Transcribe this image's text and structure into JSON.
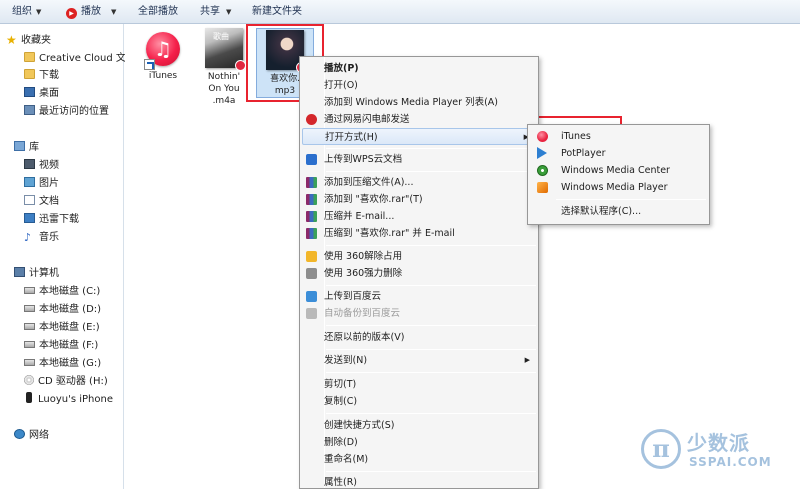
{
  "toolbar": {
    "organize": "组织",
    "play": "播放",
    "play_all": "全部播放",
    "share": "共享",
    "new_folder": "新建文件夹"
  },
  "nav": {
    "favorites_header": "收藏夹",
    "favorites": [
      "Creative Cloud 文件",
      "下载",
      "桌面",
      "最近访问的位置"
    ],
    "libraries_header": "库",
    "libraries": [
      "视频",
      "图片",
      "文档",
      "迅雷下载",
      "音乐"
    ],
    "computer_header": "计算机",
    "drives": [
      "本地磁盘 (C:)",
      "本地磁盘 (D:)",
      "本地磁盘 (E:)",
      "本地磁盘 (F:)",
      "本地磁盘 (G:)",
      "CD 驱动器 (H:)",
      "Luoyu's iPhone"
    ],
    "network": "网络"
  },
  "files": [
    {
      "label": "iTunes",
      "icon": "itunes-shortcut-icon"
    },
    {
      "label": "Nothin'\nOn You\n.m4a",
      "icon": "album-art-icon",
      "album_text": "歌曲"
    },
    {
      "label": "喜欢你.\nmp3",
      "icon": "album-art-icon",
      "selected": true
    }
  ],
  "context_menu": {
    "items": [
      {
        "label": "播放(P)",
        "bold": true
      },
      {
        "label": "打开(O)"
      },
      {
        "label": "添加到 Windows Media Player 列表(A)"
      },
      {
        "label": "通过网易闪电邮发送",
        "icon": "netease-mail-icon"
      },
      {
        "label": "打开方式(H)",
        "submenu": true
      },
      {
        "label": "上传到WPS云文档",
        "icon": "wps-icon"
      },
      {
        "label": "添加到压缩文件(A)...",
        "icon": "winrar-icon"
      },
      {
        "label": "添加到 \"喜欢你.rar\"(T)",
        "icon": "winrar-icon"
      },
      {
        "label": "压缩并 E-mail...",
        "icon": "winrar-icon"
      },
      {
        "label": "压缩到 \"喜欢你.rar\" 并 E-mail",
        "icon": "winrar-icon"
      },
      {
        "label": "使用 360解除占用",
        "icon": "360-unlock-icon"
      },
      {
        "label": "使用 360强力删除",
        "icon": "360-delete-icon"
      },
      {
        "label": "上传到百度云",
        "icon": "baidu-cloud-icon"
      },
      {
        "label": "自动备份到百度云",
        "icon": "baidu-cloud-icon",
        "disabled": true
      },
      {
        "label": "还原以前的版本(V)"
      },
      {
        "label": "发送到(N)",
        "submenu": true
      },
      {
        "label": "剪切(T)"
      },
      {
        "label": "复制(C)"
      },
      {
        "label": "创建快捷方式(S)"
      },
      {
        "label": "删除(D)"
      },
      {
        "label": "重命名(M)"
      },
      {
        "label": "属性(R)"
      }
    ]
  },
  "open_with": {
    "items": [
      {
        "label": "iTunes",
        "icon": "itunes-icon"
      },
      {
        "label": "PotPlayer",
        "icon": "potplayer-icon"
      },
      {
        "label": "Windows Media Center",
        "icon": "wmc-icon"
      },
      {
        "label": "Windows Media Player",
        "icon": "wmp-icon"
      },
      {
        "label": "选择默认程序(C)..."
      }
    ]
  },
  "watermark": {
    "cn": "少数派",
    "en": "SSPAI.COM"
  },
  "colors": {
    "highlight_box": "#e8232f",
    "menu_hover": "#dbe8f8",
    "toolbar_bg": "#dfe8f2"
  }
}
